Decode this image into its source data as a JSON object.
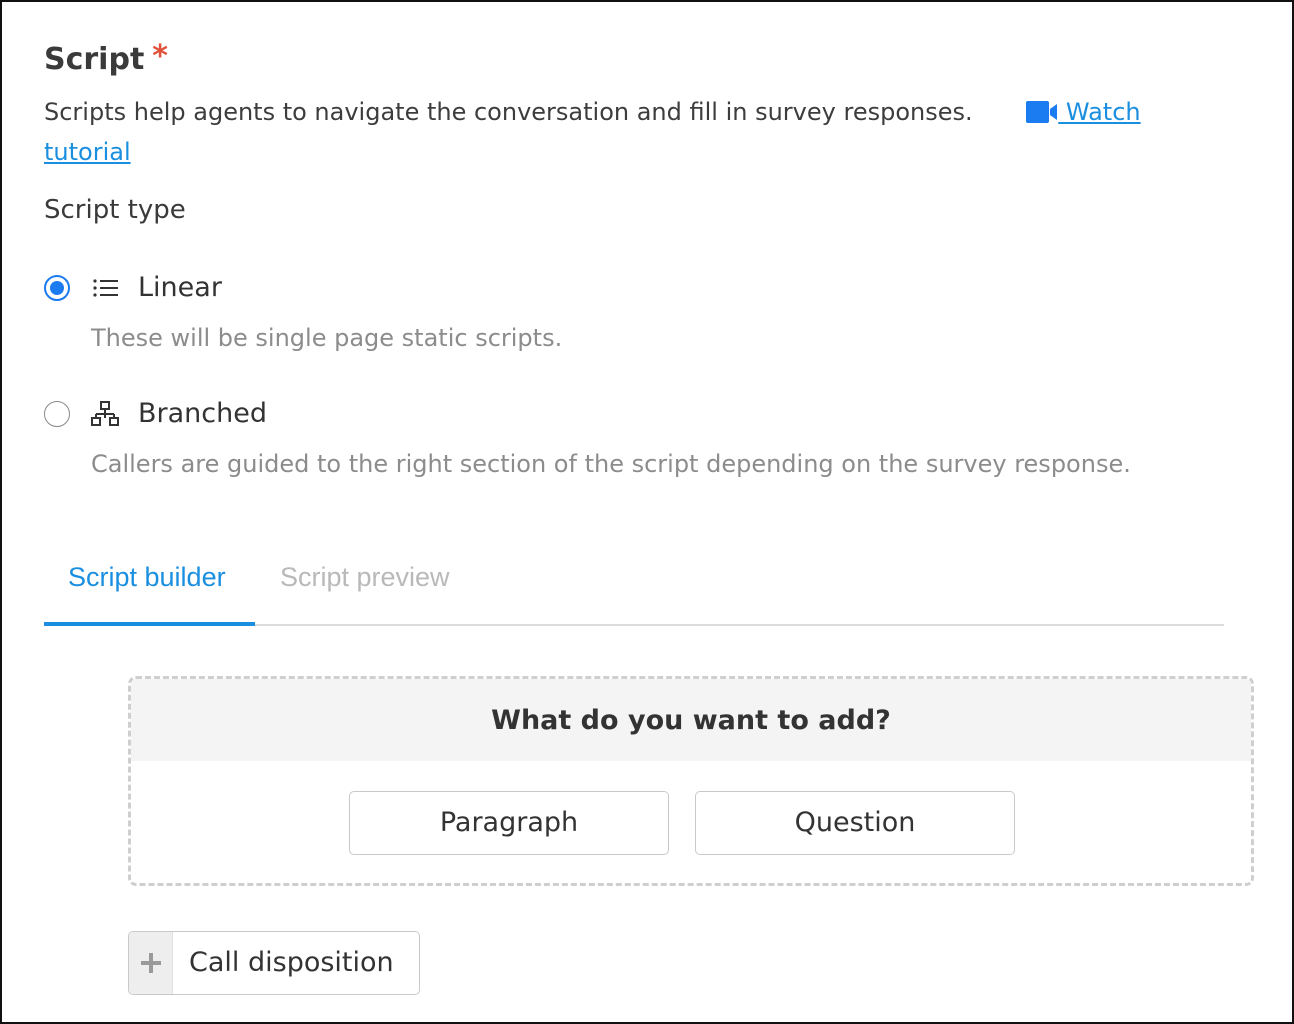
{
  "section": {
    "title": "Script",
    "required_marker": "*",
    "description": "Scripts help agents to navigate the conversation and fill in survey responses.",
    "watch_link_label": " Watch tutorial",
    "camera_icon": "video-camera-icon"
  },
  "script_type": {
    "heading": "Script type",
    "options": [
      {
        "label": "Linear",
        "help": "These will be single page static scripts.",
        "icon": "list-icon",
        "selected": true
      },
      {
        "label": "Branched",
        "help": "Callers are guided to the right section of the script depending on the survey response.",
        "icon": "hierarchy-icon",
        "selected": false
      }
    ]
  },
  "tabs": [
    {
      "label": "Script builder",
      "active": true
    },
    {
      "label": "Script preview",
      "active": false
    }
  ],
  "add_panel": {
    "heading": "What do you want to add?",
    "buttons": [
      "Paragraph",
      "Question"
    ]
  },
  "call_disposition": {
    "label": "Call disposition",
    "icon": "plus-icon"
  },
  "colors": {
    "accent": "#1a8fe0",
    "radio_selected": "#1a7cf0",
    "required": "#e0503b",
    "muted_text": "#8c8c8c"
  }
}
